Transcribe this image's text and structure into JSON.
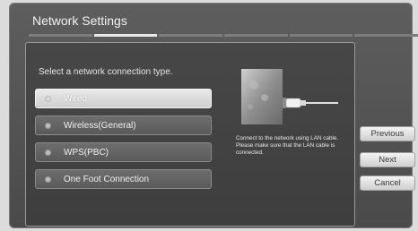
{
  "dialog": {
    "title": "Network Settings",
    "steps": [
      {
        "active": false
      },
      {
        "active": true
      },
      {
        "active": false
      },
      {
        "active": false
      },
      {
        "active": false
      },
      {
        "active": false
      }
    ]
  },
  "main": {
    "prompt": "Select a network connection type.",
    "options": [
      {
        "label": "Wired",
        "selected": true
      },
      {
        "label": "Wireless(General)",
        "selected": false
      },
      {
        "label": "WPS(PBC)",
        "selected": false
      },
      {
        "label": "One Foot Connection",
        "selected": false
      }
    ],
    "illustration_icon": "lan-cable-tv-icon",
    "description": "Connect to the network using LAN cable. Please make sure that the LAN cable is connected."
  },
  "buttons": {
    "previous": "Previous",
    "next": "Next",
    "cancel": "Cancel"
  },
  "colors": {
    "background": "#dcdcdc",
    "frame": "#555555",
    "selected_option": "#e0e0e0",
    "option": "#646464"
  }
}
